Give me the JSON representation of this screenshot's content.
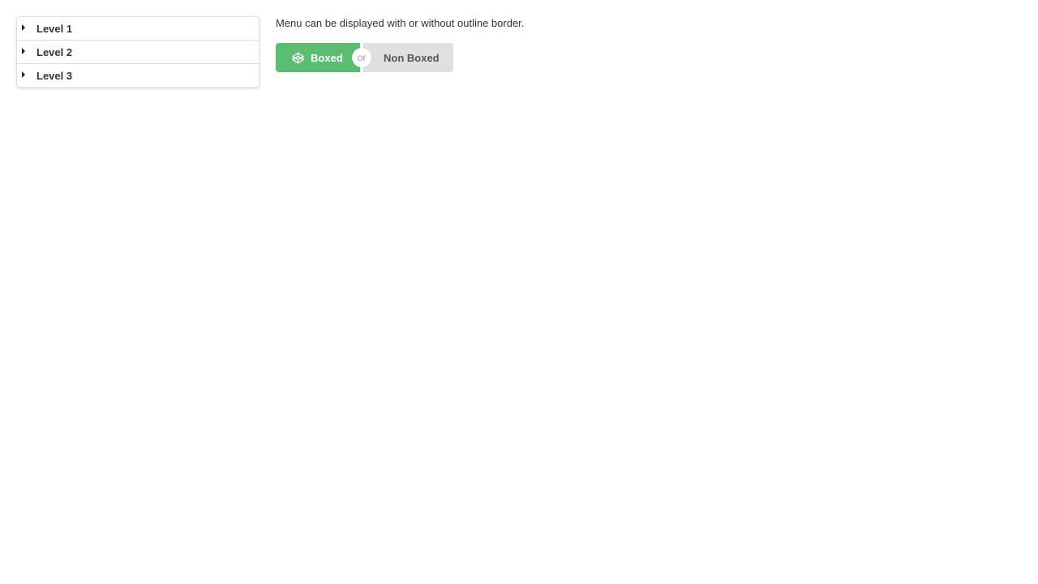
{
  "menu": {
    "items": [
      {
        "label": "Level 1"
      },
      {
        "label": "Level 2"
      },
      {
        "label": "Level 3"
      }
    ]
  },
  "description": "Menu can be displayed with or without outline border.",
  "toggle": {
    "boxed_label": "Boxed",
    "boxed_icon": "codepen-icon",
    "or_label": "or",
    "non_boxed_label": "Non Boxed"
  },
  "colors": {
    "boxed_bg": "#5bbd72",
    "non_boxed_bg": "#e0e0e0"
  }
}
